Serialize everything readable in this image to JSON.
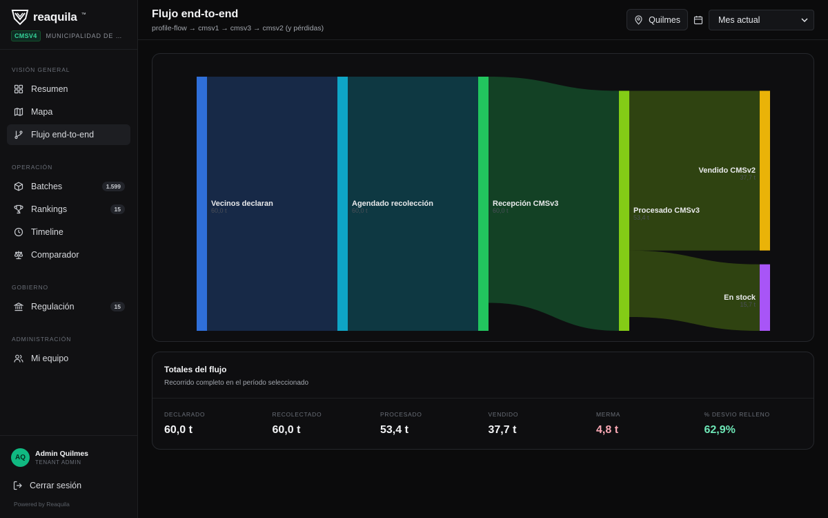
{
  "brand": {
    "name": "reaquila",
    "tm": "™",
    "tenant_badge": "CMSV4",
    "tenant_name": "MUNICIPALIDAD DE QUILMES"
  },
  "sidebar": {
    "sections": [
      {
        "label": "VISIÓN GENERAL"
      },
      {
        "label": "OPERACIÓN"
      },
      {
        "label": "GOBIERNO"
      },
      {
        "label": "ADMINISTRACIÓN"
      }
    ],
    "items": [
      {
        "label": "Resumen",
        "icon": "grid-icon"
      },
      {
        "label": "Mapa",
        "icon": "map-icon"
      },
      {
        "label": "Flujo end-to-end",
        "icon": "git-branch-icon",
        "active": true
      },
      {
        "label": "Batches",
        "icon": "package-icon",
        "count": "1.599"
      },
      {
        "label": "Rankings",
        "icon": "trophy-icon",
        "count": "15"
      },
      {
        "label": "Timeline",
        "icon": "clock-icon"
      },
      {
        "label": "Comparador",
        "icon": "scale-icon"
      },
      {
        "label": "Regulación",
        "icon": "landmark-icon",
        "count": "15"
      },
      {
        "label": "Mi equipo",
        "icon": "users-icon"
      }
    ]
  },
  "user": {
    "initials": "AQ",
    "name": "Admin Quilmes",
    "role": "TENANT ADMIN",
    "logout_label": "Cerrar sesión",
    "powered": "Powered by Reaquila"
  },
  "header": {
    "title": "Flujo end-to-end",
    "subtitle": "profile-flow → cmsv1 → cmsv3 → cmsv2 (y pérdidas)",
    "location_label": "Quilmes",
    "period_value": "Mes actual"
  },
  "chart_data": {
    "type": "sankey",
    "units": "t",
    "nodes": [
      {
        "name": "Vecinos declaran",
        "value": 60.0,
        "value_label": "60,0 t",
        "color": "#2f6fd9"
      },
      {
        "name": "Agendado recolección",
        "value": 60.0,
        "value_label": "60,0 t",
        "color": "#0ea5c6"
      },
      {
        "name": "Recepción CMSv3",
        "value": 60.0,
        "value_label": "60,0 t",
        "color": "#22c55e"
      },
      {
        "name": "Procesado CMSv3",
        "value": 53.4,
        "value_label": "53,4 t",
        "color": "#84cc16"
      },
      {
        "name": "Vendido CMSv2",
        "value": 37.7,
        "value_label": "37,7 t",
        "color": "#eab308"
      },
      {
        "name": "En stock",
        "value": 15.7,
        "value_label": "15,7 t",
        "color": "#a855f7"
      }
    ],
    "links": [
      {
        "source": "Vecinos declaran",
        "target": "Agendado recolección",
        "value": 60.0
      },
      {
        "source": "Agendado recolección",
        "target": "Recepción CMSv3",
        "value": 60.0
      },
      {
        "source": "Recepción CMSv3",
        "target": "Procesado CMSv3",
        "value": 53.4
      },
      {
        "source": "Procesado CMSv3",
        "target": "Vendido CMSv2",
        "value": 37.7
      },
      {
        "source": "Procesado CMSv3",
        "target": "En stock",
        "value": 15.7
      }
    ]
  },
  "totals": {
    "title": "Totales del flujo",
    "subtitle": "Recorrido completo en el período seleccionado",
    "metrics": [
      {
        "label": "DECLARADO",
        "value": "60,0 t"
      },
      {
        "label": "RECOLECTADO",
        "value": "60,0 t"
      },
      {
        "label": "PROCESADO",
        "value": "53,4 t"
      },
      {
        "label": "VENDIDO",
        "value": "37,7 t"
      },
      {
        "label": "MERMA",
        "value": "4,8 t",
        "tone": "loss"
      },
      {
        "label": "% DESVIO RELLENO",
        "value": "62,9%",
        "tone": "good"
      }
    ]
  }
}
